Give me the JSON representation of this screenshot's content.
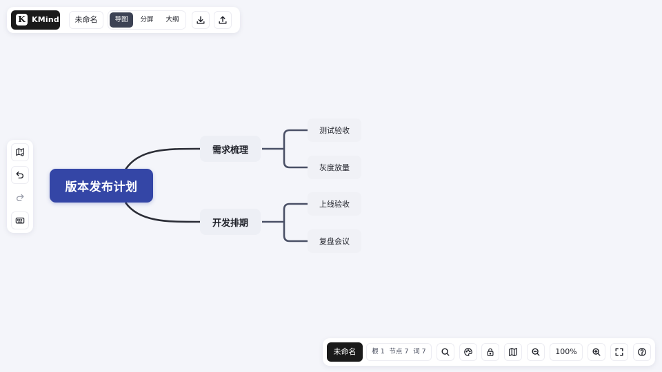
{
  "app": {
    "logo_letter": "K",
    "logo_text": "KMind",
    "doc_name": "未命名"
  },
  "view_modes": [
    {
      "label": "导图",
      "active": true
    },
    {
      "label": "分屏",
      "active": false
    },
    {
      "label": "大纲",
      "active": false
    }
  ],
  "top_actions": [
    {
      "icon": "download-icon"
    },
    {
      "icon": "upload-icon"
    }
  ],
  "left_tools": [
    {
      "icon": "map-settings-icon"
    },
    {
      "icon": "undo-icon"
    },
    {
      "icon": "redo-icon"
    },
    {
      "icon": "keyboard-icon"
    }
  ],
  "mindmap": {
    "root": "版本发布计划",
    "branches": [
      {
        "label": "需求梳理",
        "children": [
          "测试验收",
          "灰度放量"
        ]
      },
      {
        "label": "开发排期",
        "children": [
          "上线验收",
          "复盘会议"
        ]
      }
    ]
  },
  "status": {
    "doc_name": "未命名",
    "root_count": "根 1",
    "node_count": "节点 7",
    "word_count": "词 7",
    "zoom": "100%"
  },
  "bottom_actions": [
    {
      "icon": "search-icon"
    },
    {
      "icon": "theme-palette-icon"
    },
    {
      "icon": "lock-icon"
    },
    {
      "icon": "map-icon"
    },
    {
      "icon": "zoom-out-icon"
    },
    {
      "icon": "zoom-in-icon"
    },
    {
      "icon": "fullscreen-icon"
    },
    {
      "icon": "help-icon"
    }
  ],
  "colors": {
    "background": "#f4f5fa",
    "root_fill": "#3446a6",
    "branch_fill": "#edeff5",
    "leaf_fill": "#f0f1f6",
    "root_connector": "#2b2d36",
    "leaf_connector": "#4a5066",
    "dark_button": "#1a1a1a",
    "active_tab": "#3c4254"
  }
}
